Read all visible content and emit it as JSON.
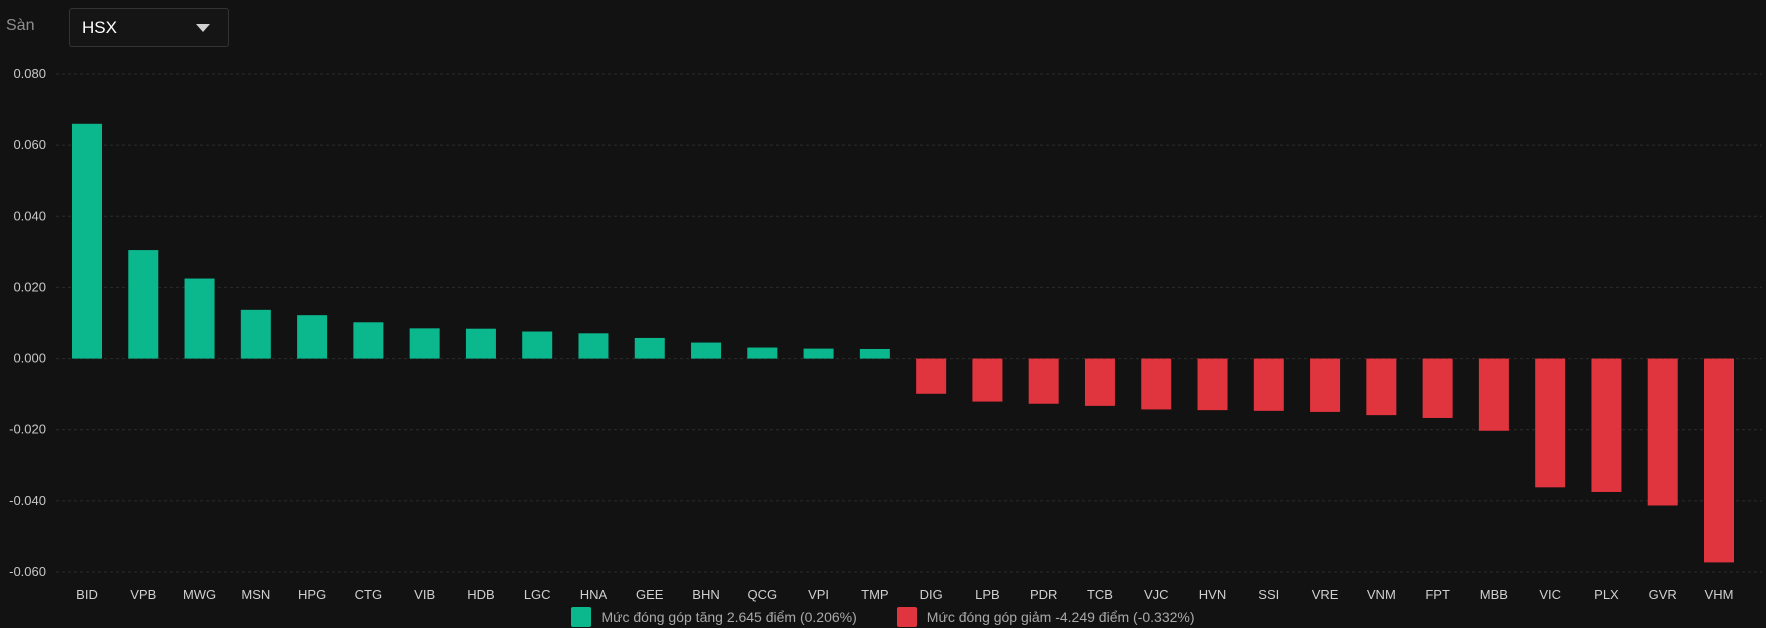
{
  "filter": {
    "label": "Sàn",
    "selected": "HSX"
  },
  "chart_data": {
    "type": "bar",
    "categories": [
      "BID",
      "VPB",
      "MWG",
      "MSN",
      "HPG",
      "CTG",
      "VIB",
      "HDB",
      "LGC",
      "HNA",
      "GEE",
      "BHN",
      "QCG",
      "VPI",
      "TMP",
      "DIG",
      "LPB",
      "PDR",
      "TCB",
      "VJC",
      "HVN",
      "SSI",
      "VRE",
      "VNM",
      "FPT",
      "MBB",
      "VIC",
      "PLX",
      "GVR",
      "VHM"
    ],
    "values": [
      0.066,
      0.0305,
      0.0225,
      0.0137,
      0.0122,
      0.0102,
      0.0085,
      0.0084,
      0.0076,
      0.0071,
      0.0058,
      0.0045,
      0.0031,
      0.0028,
      0.0027,
      -0.0099,
      -0.0121,
      -0.0127,
      -0.0133,
      -0.0143,
      -0.0145,
      -0.0147,
      -0.015,
      -0.0159,
      -0.0167,
      -0.0203,
      -0.0362,
      -0.0375,
      -0.0413,
      -0.0573
    ],
    "ylim": [
      -0.06,
      0.08
    ],
    "yticks": [
      "0.080",
      "0.060",
      "0.040",
      "0.020",
      "0.000",
      "-0.020",
      "-0.040",
      "-0.060"
    ],
    "colors": {
      "positive": "#0bb88d",
      "negative": "#e0343f",
      "grid": "#2c2c2c"
    },
    "grid": true,
    "legend_position": "bottom-center",
    "legend": [
      {
        "label": "Mức đóng góp tăng 2.645 điểm (0.206%)",
        "color": "#0bb88d"
      },
      {
        "label": "Mức đóng góp giảm -4.249 điểm (-0.332%)",
        "color": "#e0343f"
      }
    ]
  }
}
